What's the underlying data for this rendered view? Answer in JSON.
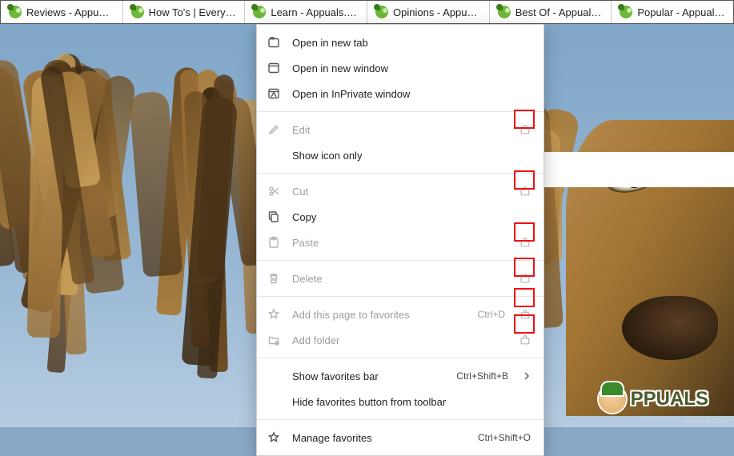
{
  "favorites": [
    {
      "label": "Reviews - Appuals.c..."
    },
    {
      "label": "How To's | Everythi..."
    },
    {
      "label": "Learn - Appuals.com"
    },
    {
      "label": "Opinions - Appuals..."
    },
    {
      "label": "Best Of - Appuals.c..."
    },
    {
      "label": "Popular - Appuals.c..."
    }
  ],
  "menu": {
    "open_new_tab": "Open in new tab",
    "open_new_window": "Open in new window",
    "open_inprivate": "Open in InPrivate window",
    "edit": "Edit",
    "show_icon_only": "Show icon only",
    "cut": "Cut",
    "copy": "Copy",
    "paste": "Paste",
    "delete": "Delete",
    "add_page": "Add this page to favorites",
    "add_page_shortcut": "Ctrl+D",
    "add_folder": "Add folder",
    "show_fav_bar": "Show favorites bar",
    "show_fav_bar_shortcut": "Ctrl+Shift+B",
    "hide_fav_button": "Hide favorites button from toolbar",
    "manage_fav": "Manage favorites",
    "manage_fav_shortcut": "Ctrl+Shift+O"
  },
  "branding": {
    "logo_text": "PPUALS",
    "watermark": "wsxdn.com"
  }
}
